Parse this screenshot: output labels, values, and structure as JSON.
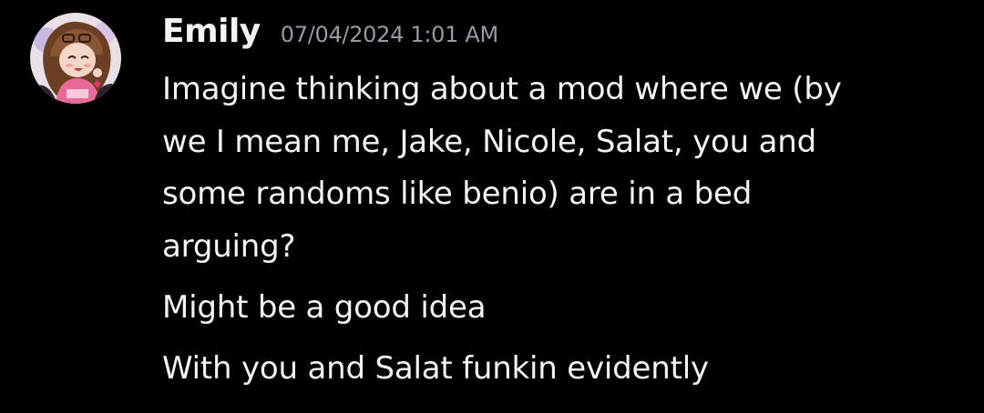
{
  "message": {
    "author": "Emily",
    "timestamp": "07/04/2024 1:01 AM",
    "avatar": "avatar-image",
    "lines": [
      "Imagine thinking about a mod where we (by",
      "we I mean me, Jake, Nicole, Salat, you and",
      "some randoms like benio) are in a bed",
      "arguing?",
      "Might be a good idea",
      "With you and Salat funkin evidently"
    ]
  },
  "colors": {
    "background": "#000000",
    "text": "#f2f3f5",
    "timestamp": "#949ba4"
  }
}
